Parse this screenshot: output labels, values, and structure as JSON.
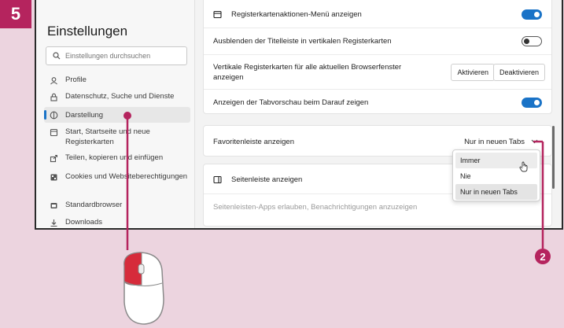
{
  "step": {
    "number": "5"
  },
  "sidebar": {
    "title": "Einstellungen",
    "search_placeholder": "Einstellungen durchsuchen",
    "items": [
      {
        "label": "Profile",
        "icon": "profile-icon"
      },
      {
        "label": "Datenschutz, Suche und Dienste",
        "icon": "lock-icon"
      },
      {
        "label": "Darstellung",
        "icon": "appearance-icon",
        "active": true
      },
      {
        "label": "Start, Startseite und neue Registerkarten",
        "icon": "home-icon"
      },
      {
        "label": "Teilen, kopieren und einfügen",
        "icon": "share-icon"
      },
      {
        "label": "Cookies und Websiteberechtigungen",
        "icon": "cookie-icon"
      },
      {
        "label": "Standardbrowser",
        "icon": "browser-icon"
      },
      {
        "label": "Downloads",
        "icon": "download-icon"
      }
    ]
  },
  "settings": {
    "tab_actions_menu": "Registerkartenaktionen-Menü anzeigen",
    "hide_titlebar": "Ausblenden der Titelleiste in vertikalen Registerkarten",
    "vertical_tabs": "Vertikale Registerkarten für alle aktuellen Browserfenster anzeigen",
    "activate": "Aktivieren",
    "deactivate": "Deaktivieren",
    "tab_preview": "Anzeigen der Tabvorschau beim Darauf zeigen",
    "favorites_bar": "Favoritenleiste anzeigen",
    "favorites_value": "Nur in neuen Tabs",
    "sidebar_show": "Seitenleiste anzeigen",
    "sidebar_apps": "Seitenleisten-Apps erlauben, Benachrichtigungen anzuzeigen"
  },
  "dropdown": {
    "options": [
      "Immer",
      "Nie",
      "Nur in neuen Tabs"
    ]
  },
  "callouts": {
    "two": "2"
  },
  "colors": {
    "accent": "#1a73c7",
    "brand": "#b5245e"
  }
}
